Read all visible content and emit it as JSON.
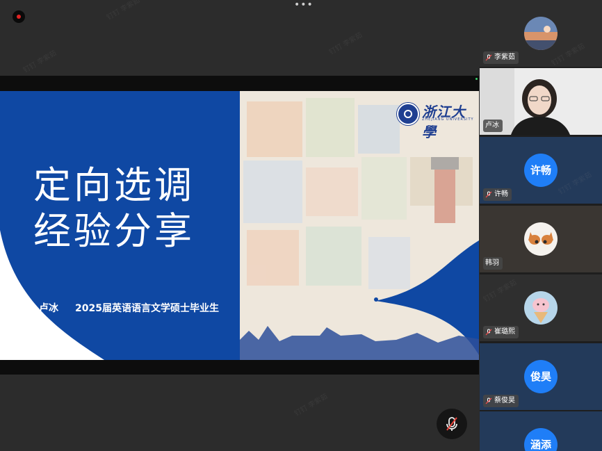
{
  "meeting": {
    "watermark": "钉钉 李紫茹"
  },
  "slide": {
    "title_line1": "定向选调",
    "title_line2": "经验分享",
    "presenter": "卢冰",
    "degree": "2025届英语语言文学硕士毕业生",
    "logo_cn": "浙江大學",
    "logo_en": "ZHEJIANG UNIVERSITY",
    "colors": {
      "primary": "#0f48a3",
      "accent": "#1f3f91"
    }
  },
  "participants": [
    {
      "name": "李紫茹",
      "avatar_type": "photo-landscape",
      "muted": true
    },
    {
      "name": "卢冰",
      "avatar_type": "camera-video",
      "muted": false
    },
    {
      "name": "许畅",
      "avatar_label": "许畅",
      "avatar_type": "text",
      "muted": true
    },
    {
      "name": "韩羽",
      "avatar_type": "photo-cat",
      "muted": false
    },
    {
      "name": "崔璐熙",
      "avatar_type": "photo-dessert",
      "muted": true
    },
    {
      "name": "蔡俊昊",
      "avatar_label": "俊昊",
      "avatar_type": "text",
      "muted": true
    },
    {
      "name": "",
      "avatar_label": "涵添",
      "avatar_type": "text",
      "muted": false
    }
  ],
  "icons": {
    "record": "record-icon",
    "more": "more-options-icon",
    "mute_toggle": "mic-muted-icon"
  }
}
